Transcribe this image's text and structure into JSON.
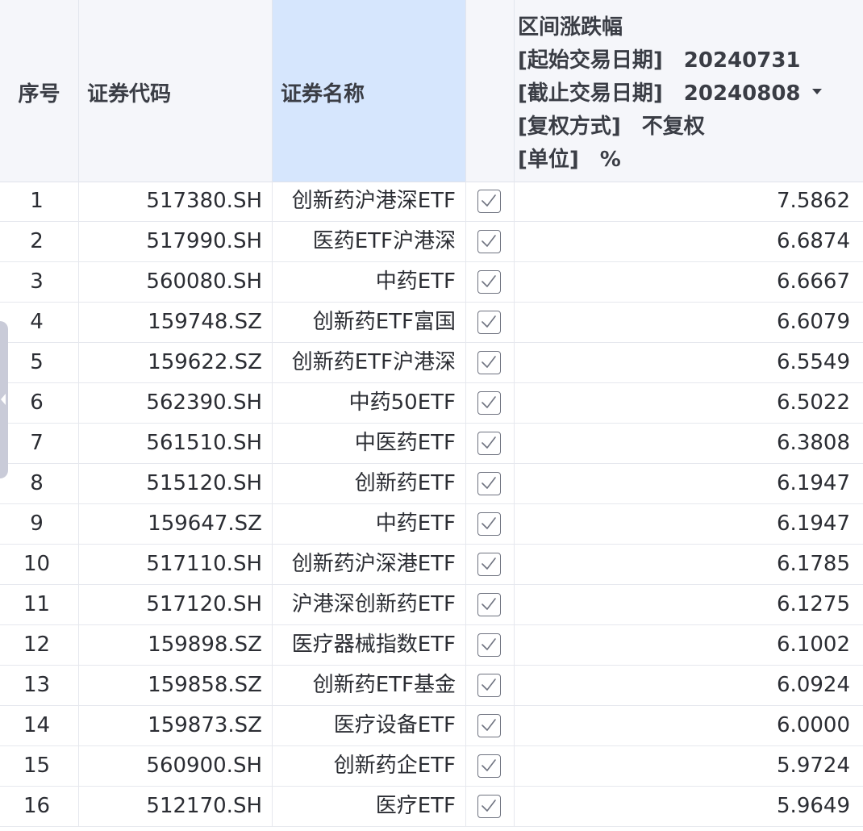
{
  "header": {
    "idx": "序号",
    "code": "证券代码",
    "name": "证券名称",
    "value_title": "区间涨跌幅",
    "start_label": "[起始交易日期]",
    "start_value": "20240731",
    "end_label": "[截止交易日期]",
    "end_value": "20240808",
    "adjust_label": "[复权方式]",
    "adjust_value": "不复权",
    "unit_label": "[单位]",
    "unit_value": "%"
  },
  "rows": [
    {
      "idx": "1",
      "code": "517380.SH",
      "name": "创新药沪港深ETF",
      "value": "7.5862"
    },
    {
      "idx": "2",
      "code": "517990.SH",
      "name": "医药ETF沪港深",
      "value": "6.6874"
    },
    {
      "idx": "3",
      "code": "560080.SH",
      "name": "中药ETF",
      "value": "6.6667"
    },
    {
      "idx": "4",
      "code": "159748.SZ",
      "name": "创新药ETF富国",
      "value": "6.6079"
    },
    {
      "idx": "5",
      "code": "159622.SZ",
      "name": "创新药ETF沪港深",
      "value": "6.5549"
    },
    {
      "idx": "6",
      "code": "562390.SH",
      "name": "中药50ETF",
      "value": "6.5022"
    },
    {
      "idx": "7",
      "code": "561510.SH",
      "name": "中医药ETF",
      "value": "6.3808"
    },
    {
      "idx": "8",
      "code": "515120.SH",
      "name": "创新药ETF",
      "value": "6.1947"
    },
    {
      "idx": "9",
      "code": "159647.SZ",
      "name": "中药ETF",
      "value": "6.1947"
    },
    {
      "idx": "10",
      "code": "517110.SH",
      "name": "创新药沪深港ETF",
      "value": "6.1785"
    },
    {
      "idx": "11",
      "code": "517120.SH",
      "name": "沪港深创新药ETF",
      "value": "6.1275"
    },
    {
      "idx": "12",
      "code": "159898.SZ",
      "name": "医疗器械指数ETF",
      "value": "6.1002"
    },
    {
      "idx": "13",
      "code": "159858.SZ",
      "name": "创新药ETF基金",
      "value": "6.0924"
    },
    {
      "idx": "14",
      "code": "159873.SZ",
      "name": "医疗设备ETF",
      "value": "6.0000"
    },
    {
      "idx": "15",
      "code": "560900.SH",
      "name": "创新药企ETF",
      "value": "5.9724"
    },
    {
      "idx": "16",
      "code": "512170.SH",
      "name": "医疗ETF",
      "value": "5.9649"
    }
  ],
  "colors": {
    "header_bg": "#f5f6fa",
    "selected_column_bg": "#d6e6fd",
    "grid_line": "#e6e8ee",
    "side_tab": "#c9cbd8"
  },
  "icons": {
    "checkbox": "checkbox-checked-icon",
    "sort": "caret-down-icon",
    "side_tab_arrow": "chevron-left-icon"
  }
}
